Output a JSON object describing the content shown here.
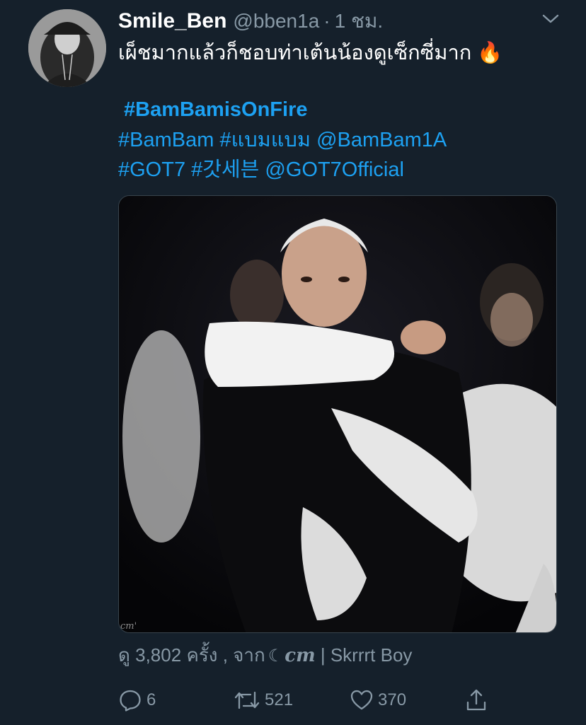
{
  "tweet": {
    "display_name": "Smile_Ben",
    "handle": "@bben1a",
    "separator": "·",
    "time": "1 ชม.",
    "text": "เผ็ชมากแล้วก็ชอบท่าเต้นน้องดูเซ็กซี่มาก",
    "emoji": "🔥",
    "featured_hashtag": "#BamBamisOnFire",
    "tags_line1": [
      "#BamBam",
      "#แบมแบม",
      "@BamBam1A"
    ],
    "tags_line2": [
      "#GOT7",
      "#갓세븐",
      "@GOT7Official"
    ]
  },
  "media": {
    "watermark": "cm'"
  },
  "views": {
    "prefix": "ดู",
    "count": "3,802",
    "suffix": "ครั้ง , จาก",
    "moon": "☾",
    "source_name": "cm",
    "separator": "|",
    "app": "Skrrrt Boy"
  },
  "actions": {
    "reply_count": "6",
    "retweet_count": "521",
    "like_count": "370"
  },
  "colors": {
    "background": "#15202b",
    "text": "#ffffff",
    "secondary": "#8899a6",
    "link": "#1da1f2"
  },
  "icons": [
    "chevron-down-icon",
    "fire-emoji",
    "reply-icon",
    "retweet-icon",
    "like-icon",
    "share-icon"
  ]
}
